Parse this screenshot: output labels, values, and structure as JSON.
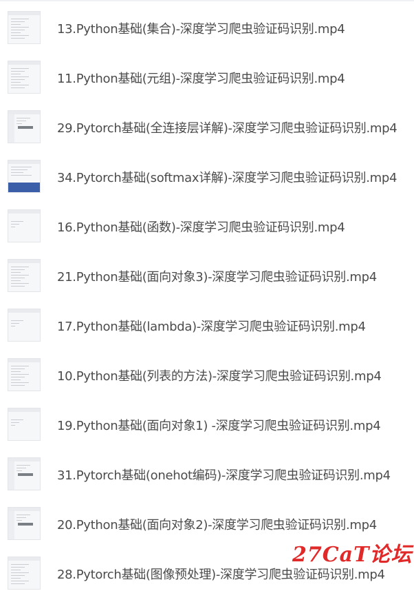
{
  "files": [
    {
      "name": "13.Python基础(集合)-深度学习爬虫验证码识别.mp4",
      "thumb": "code"
    },
    {
      "name": "11.Python基础(元组)-深度学习爬虫验证码识别.mp4",
      "thumb": "code"
    },
    {
      "name": "29.Pytorch基础(全连接层详解)-深度学习爬虫验证码识别.mp4",
      "thumb": "ide"
    },
    {
      "name": "34.Pytorch基础(softmax详解)-深度学习爬虫验证码识别.mp4",
      "thumb": "blue"
    },
    {
      "name": "16.Python基础(函数)-深度学习爬虫验证码识别.mp4",
      "thumb": "plain"
    },
    {
      "name": "21.Python基础(面向对象3)-深度学习爬虫验证码识别.mp4",
      "thumb": "code"
    },
    {
      "name": "17.Python基础(lambda)-深度学习爬虫验证码识别.mp4",
      "thumb": "plain"
    },
    {
      "name": "10.Python基础(列表的方法)-深度学习爬虫验证码识别.mp4",
      "thumb": "code"
    },
    {
      "name": "19.Python基础(面向对象1) -深度学习爬虫验证码识别.mp4",
      "thumb": "plain"
    },
    {
      "name": "31.Pytorch基础(onehot编码)-深度学习爬虫验证码识别.mp4",
      "thumb": "ide"
    },
    {
      "name": "20.Python基础(面向对象2)-深度学习爬虫验证码识别.mp4",
      "thumb": "ide"
    },
    {
      "name": "28.Pytorch基础(图像预处理)-深度学习爬虫验证码识别.mp4",
      "thumb": "code"
    }
  ],
  "watermark": "27CaT论坛",
  "colors": {
    "text": "#4b4b4b",
    "watermark": "#e02a2a"
  }
}
